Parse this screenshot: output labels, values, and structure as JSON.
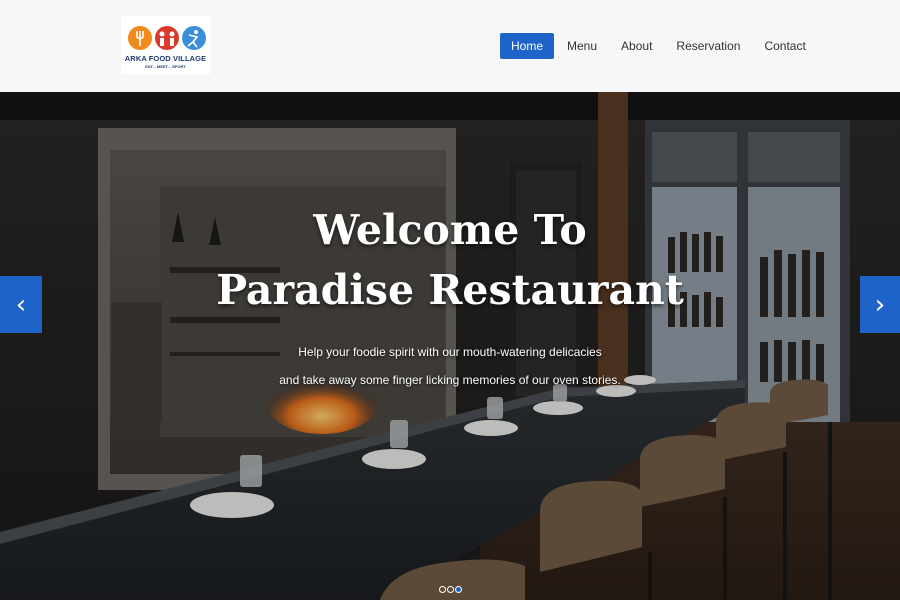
{
  "brand": {
    "logo_title": "ARKA FOOD VILLAGE",
    "logo_tagline": "EAT... MEET... SPORT",
    "logo_icons": [
      "fork-spoon-icon",
      "people-icon",
      "sport-player-icon"
    ],
    "colors": {
      "orange": "#f08a1c",
      "red": "#d93a2b",
      "blue": "#3b8fd9"
    }
  },
  "nav": {
    "items": [
      {
        "label": "Home",
        "active": true
      },
      {
        "label": "Menu",
        "active": false
      },
      {
        "label": "About",
        "active": false
      },
      {
        "label": "Reservation",
        "active": false
      },
      {
        "label": "Contact",
        "active": false
      }
    ]
  },
  "hero": {
    "title_line1": "Welcome To",
    "title_line2": "Paradise Restaurant",
    "subtitle_line1": "Help your foodie spirit with our mouth-watering delicacies",
    "subtitle_line2": "and take away some finger licking memories of our oven stories.",
    "prev_icon": "‹",
    "next_icon": "›",
    "slides": 3,
    "active_slide": 3
  },
  "theme": {
    "accent": "#1e63c8",
    "header_bg": "#f7f7f9"
  }
}
